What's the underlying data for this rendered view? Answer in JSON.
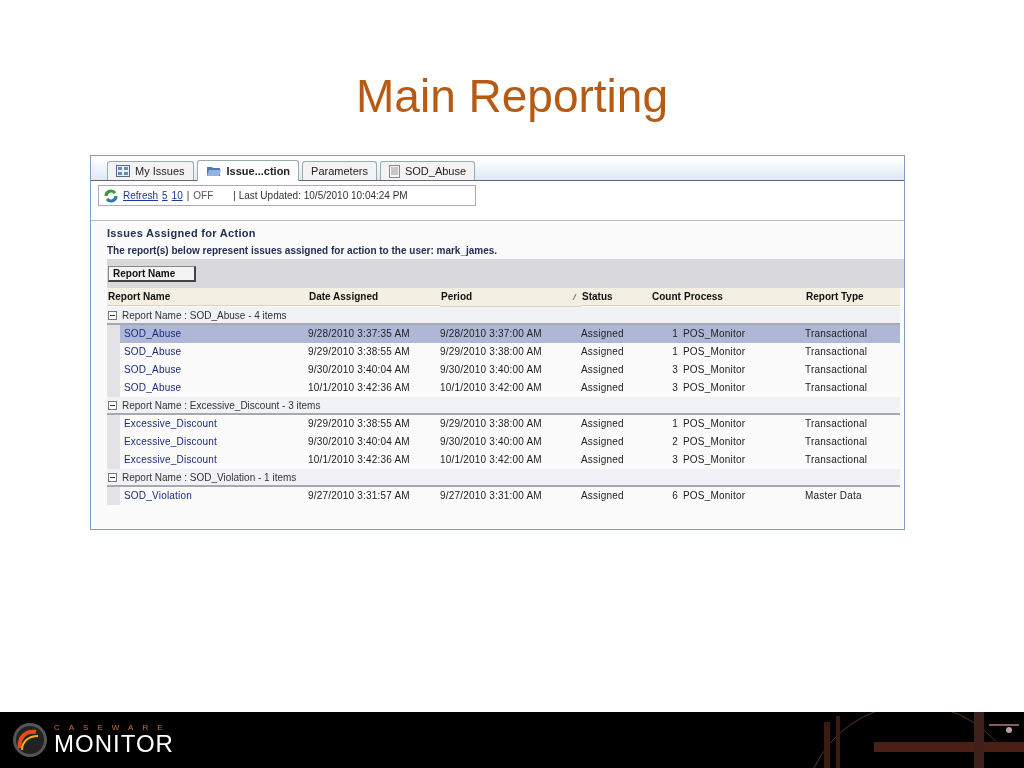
{
  "slide": {
    "title": "Main Reporting"
  },
  "tabs": [
    {
      "label": "My Issues",
      "selected": false
    },
    {
      "label": "Issue...ction",
      "selected": true
    },
    {
      "label": "Parameters",
      "selected": false
    },
    {
      "label": "SOD_Abuse",
      "selected": false
    }
  ],
  "toolbar": {
    "refresh": "Refresh",
    "intervals": [
      "5",
      "10"
    ],
    "separator": "|",
    "off": "OFF",
    "last_updated": "| Last Updated: 10/5/2010 10:04:24 PM"
  },
  "section": {
    "title": "Issues Assigned for Action",
    "description": "The report(s) below represent issues assigned for action to the user: mark_james.",
    "group_button": "Report Name"
  },
  "table": {
    "columns": [
      "Report Name",
      "Date Assigned",
      "Period",
      "Status",
      "Count",
      "Process",
      "Report Type"
    ],
    "groups": [
      {
        "label": "Report Name : SOD_Abuse - 4 items",
        "expanded": true,
        "rows": [
          {
            "cells": [
              "SOD_Abuse",
              "9/28/2010 3:37:35 AM",
              "9/28/2010 3:37:00 AM",
              "Assigned",
              "1",
              "POS_Monitor",
              "Transactional"
            ],
            "selected": true
          },
          {
            "cells": [
              "SOD_Abuse",
              "9/29/2010 3:38:55 AM",
              "9/29/2010 3:38:00 AM",
              "Assigned",
              "1",
              "POS_Monitor",
              "Transactional"
            ],
            "selected": false
          },
          {
            "cells": [
              "SOD_Abuse",
              "9/30/2010 3:40:04 AM",
              "9/30/2010 3:40:00 AM",
              "Assigned",
              "3",
              "POS_Monitor",
              "Transactional"
            ],
            "selected": false
          },
          {
            "cells": [
              "SOD_Abuse",
              "10/1/2010 3:42:36 AM",
              "10/1/2010 3:42:00 AM",
              "Assigned",
              "3",
              "POS_Monitor",
              "Transactional"
            ],
            "selected": false
          }
        ]
      },
      {
        "label": "Report Name : Excessive_Discount - 3 items",
        "expanded": true,
        "rows": [
          {
            "cells": [
              "Excessive_Discount",
              "9/29/2010 3:38:55 AM",
              "9/29/2010 3:38:00 AM",
              "Assigned",
              "1",
              "POS_Monitor",
              "Transactional"
            ],
            "selected": false
          },
          {
            "cells": [
              "Excessive_Discount",
              "9/30/2010 3:40:04 AM",
              "9/30/2010 3:40:00 AM",
              "Assigned",
              "2",
              "POS_Monitor",
              "Transactional"
            ],
            "selected": false
          },
          {
            "cells": [
              "Excessive_Discount",
              "10/1/2010 3:42:36 AM",
              "10/1/2010 3:42:00 AM",
              "Assigned",
              "3",
              "POS_Monitor",
              "Transactional"
            ],
            "selected": false
          }
        ]
      },
      {
        "label": "Report Name : SOD_Violation - 1 items",
        "expanded": true,
        "rows": [
          {
            "cells": [
              "SOD_Violation",
              "9/27/2010 3:31:57 AM",
              "9/27/2010 3:31:00 AM",
              "Assigned",
              "6",
              "POS_Monitor",
              "Master Data"
            ],
            "selected": false
          }
        ]
      }
    ]
  },
  "footer": {
    "brand": "CASEWARE",
    "product": "MONITOR"
  }
}
